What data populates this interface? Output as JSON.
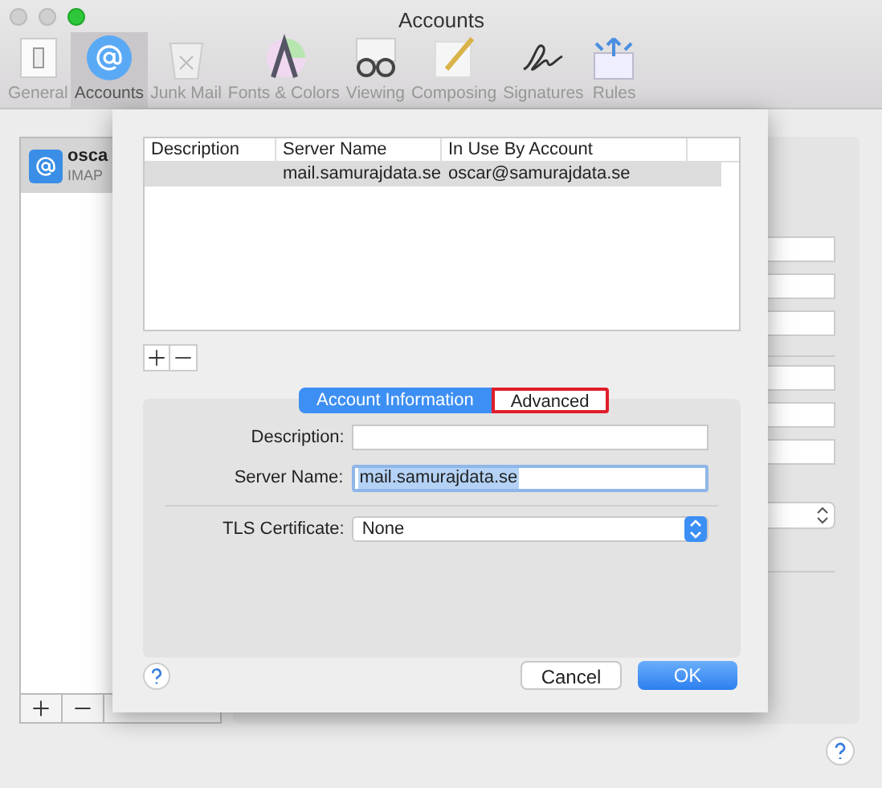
{
  "window": {
    "title": "Accounts"
  },
  "toolbar": [
    {
      "label": "General",
      "kind": "general",
      "selected": false
    },
    {
      "label": "Accounts",
      "kind": "accounts",
      "selected": true
    },
    {
      "label": "Junk Mail",
      "kind": "junk",
      "selected": false
    },
    {
      "label": "Fonts & Colors",
      "kind": "fonts",
      "selected": false
    },
    {
      "label": "Viewing",
      "kind": "viewing",
      "selected": false
    },
    {
      "label": "Composing",
      "kind": "composing",
      "selected": false
    },
    {
      "label": "Signatures",
      "kind": "signatures",
      "selected": false
    },
    {
      "label": "Rules",
      "kind": "rules",
      "selected": false
    }
  ],
  "accounts_list": {
    "items": [
      {
        "name": "osca",
        "type": "IMAP",
        "selected": true
      }
    ]
  },
  "sheet": {
    "table": {
      "columns": [
        "Description",
        "Server Name",
        "In Use By Account"
      ],
      "rows": [
        {
          "server_name": "mail.samurajdata.se",
          "account": "oscar@samurajdata.se",
          "selected": true
        }
      ]
    },
    "tabs": [
      {
        "label": "Account Information",
        "selected": true,
        "highlighted": false
      },
      {
        "label": "Advanced",
        "selected": false,
        "highlighted": true
      }
    ],
    "form": {
      "description": {
        "label": "Description:"
      },
      "server_name": {
        "label": "Server Name:",
        "value": "mail.samurajdata.se",
        "text_selected": true
      },
      "tls_certificate": {
        "label": "TLS Certificate:",
        "value": "None"
      }
    },
    "buttons": [
      {
        "label": "Cancel",
        "kind": "default"
      },
      {
        "label": "OK",
        "kind": "primary"
      }
    ]
  }
}
